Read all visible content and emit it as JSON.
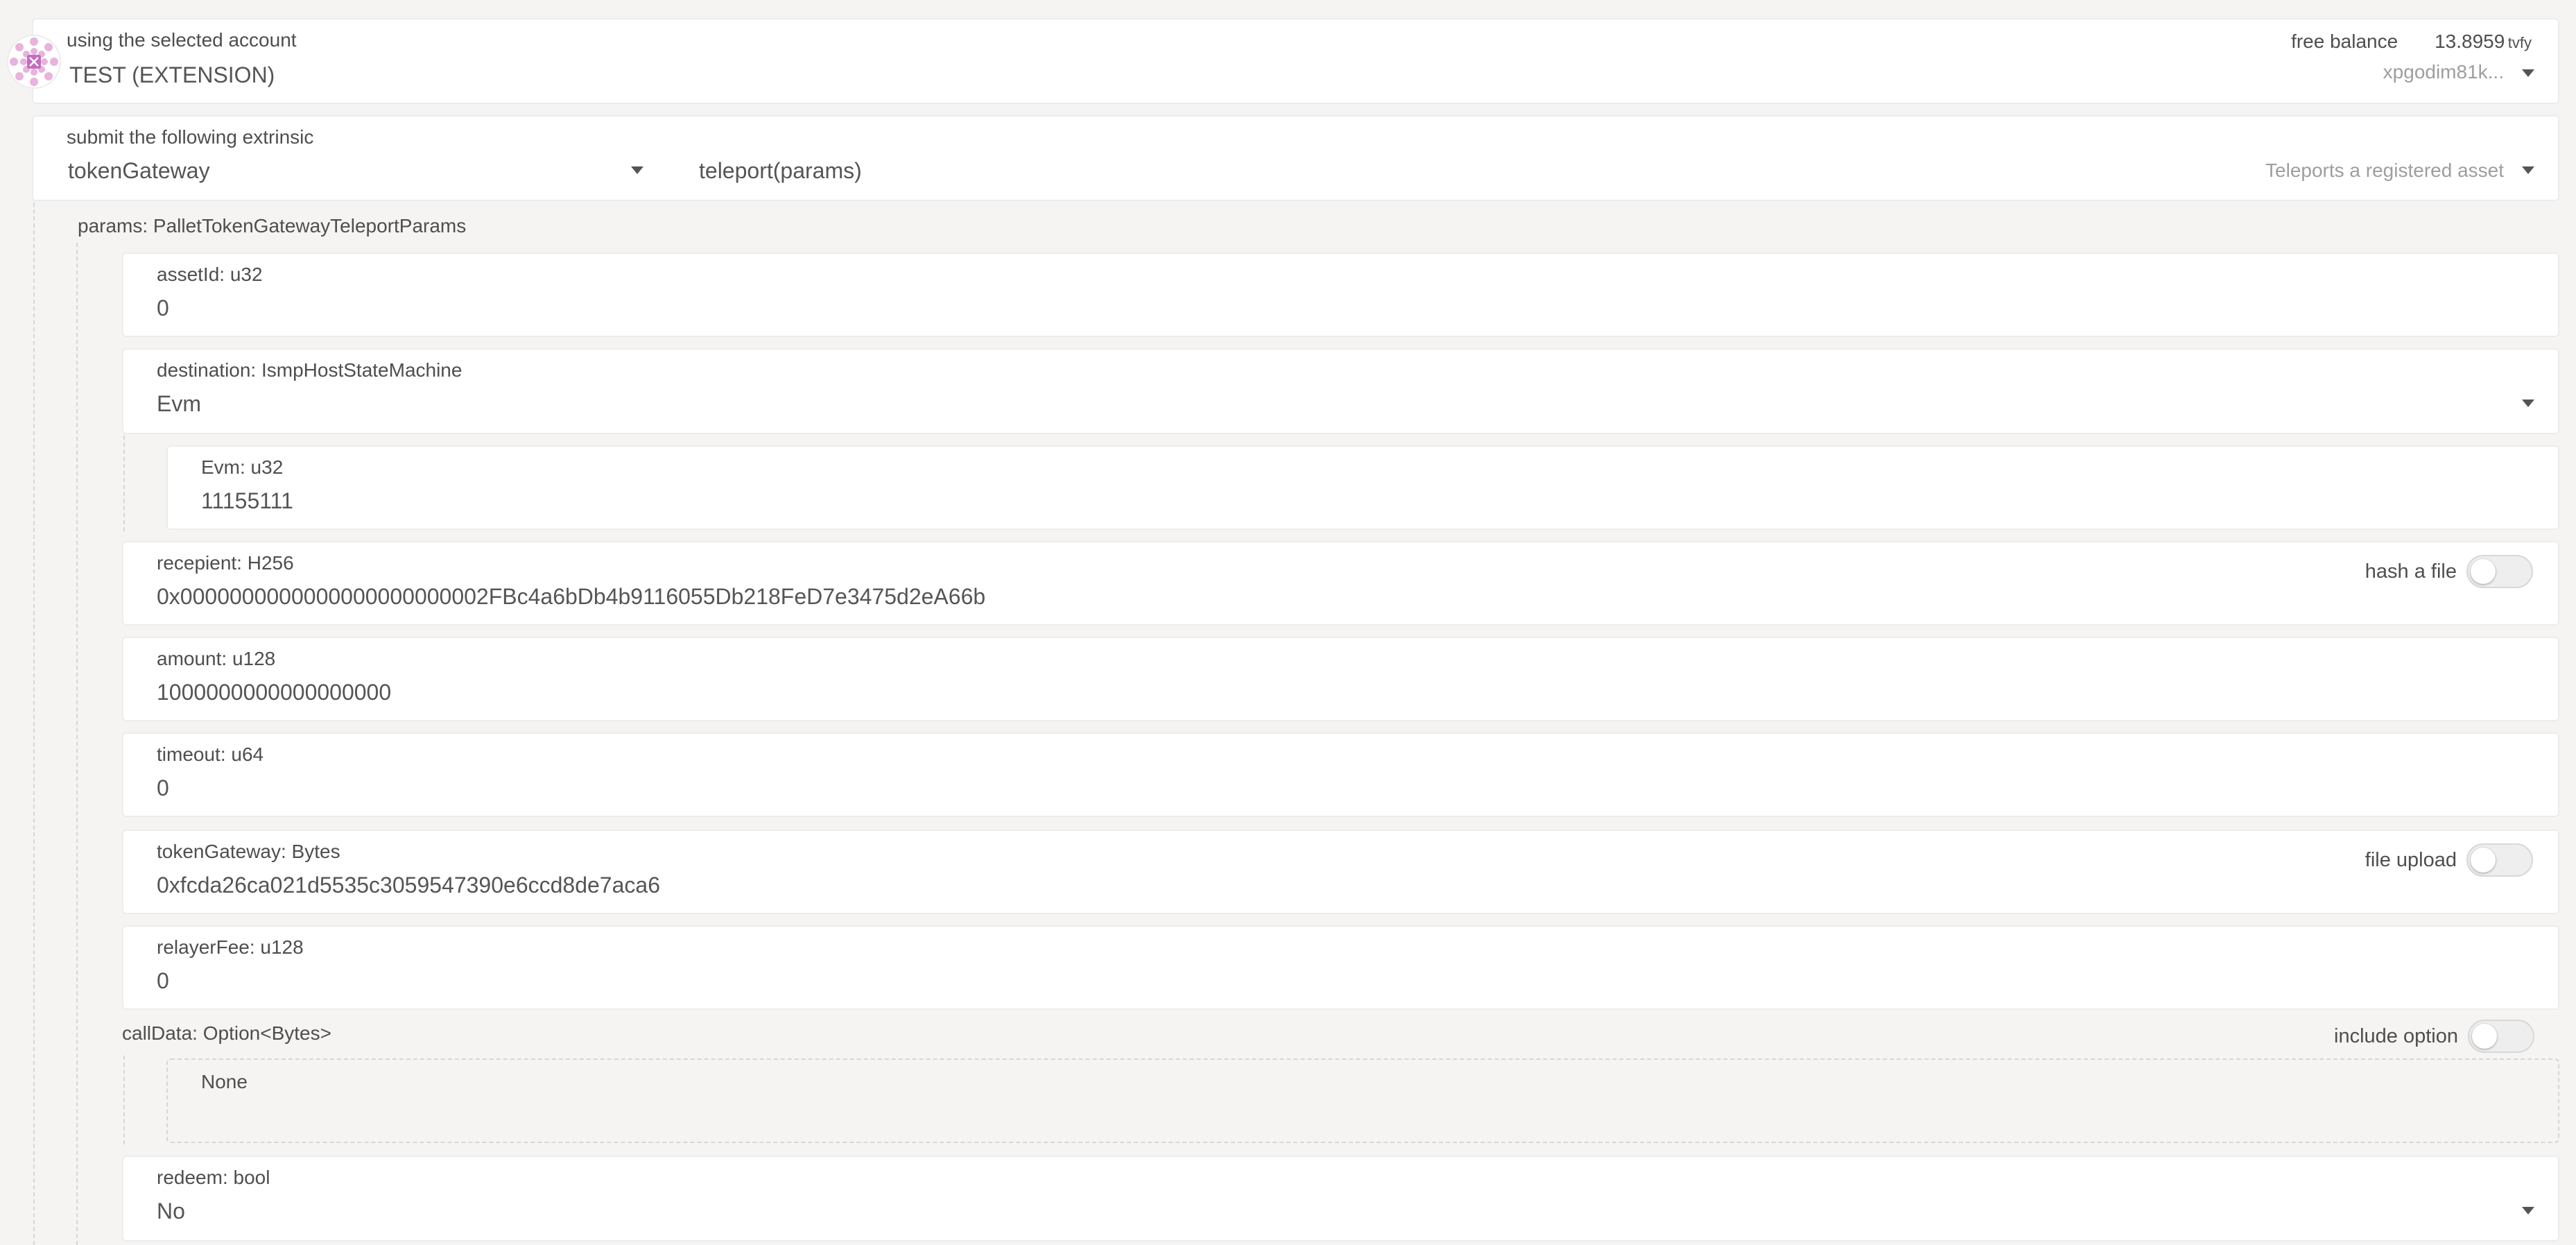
{
  "account": {
    "title": "using the selected account",
    "name": "TEST (EXTENSION)",
    "balance_label": "free balance",
    "balance_value": "13.8959",
    "balance_unit": "tvfy",
    "address": "xpgodim81k..."
  },
  "extrinsic": {
    "title": "submit the following extrinsic",
    "pallet": "tokenGateway",
    "method": "teleport(params)",
    "description": "Teleports a registered asset"
  },
  "params": {
    "title": "params: PalletTokenGatewayTeleportParams",
    "assetId": {
      "label": "assetId: u32",
      "value": "0"
    },
    "destination": {
      "label": "destination: IsmpHostStateMachine",
      "value": "Evm"
    },
    "evm": {
      "label": "Evm: u32",
      "value": "11155111"
    },
    "recepient": {
      "label": "recepient: H256",
      "value": "0x0000000000000000000000002FBc4a6bDb4b9116055Db218FeD7e3475d2eA66b",
      "toggle_label": "hash a file"
    },
    "amount": {
      "label": "amount: u128",
      "value": "1000000000000000000"
    },
    "timeout": {
      "label": "timeout: u64",
      "value": "0"
    },
    "tokenGateway": {
      "label": "tokenGateway: Bytes",
      "value": "0xfcda26ca021d5535c3059547390e6ccd8de7aca6",
      "toggle_label": "file upload"
    },
    "relayerFee": {
      "label": "relayerFee: u128",
      "value": "0"
    },
    "callData": {
      "label": "callData: Option<Bytes>",
      "toggle_label": "include option",
      "value": "None"
    },
    "redeem": {
      "label": "redeem: bool",
      "value": "No"
    }
  },
  "colors": {
    "accent": "#e6007a",
    "background": "#f5f4f3",
    "card": "#ffffff",
    "border": "#ececec"
  },
  "icons": [
    "identicon",
    "chevron-down-icon",
    "toggle-switch"
  ]
}
